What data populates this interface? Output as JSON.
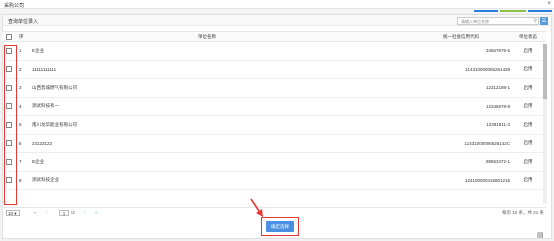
{
  "topbar": {
    "title": "采购公司",
    "close": "×"
  },
  "strip_colors": [
    "#2a7de1",
    "#8bc34a",
    "#2a7de1"
  ],
  "dialog": {
    "title": "查询单位录入",
    "close": "×",
    "search_placeholder": "请输入单位名称",
    "search_icon": "search-icon",
    "confirm_label": "确定选择"
  },
  "table": {
    "headers": {
      "index": "序",
      "name": "单位名称",
      "code": "统一社会信用代码",
      "status": "单位状态"
    },
    "rows": [
      {
        "index": "1",
        "name": "E企业",
        "code": "34567675-5",
        "status": "启用"
      },
      {
        "index": "2",
        "name": "11111111111",
        "code": "114310000065261428",
        "status": "启用"
      },
      {
        "index": "3",
        "name": "山西晋城燃气有限公司",
        "code": "12312198-1",
        "status": "启用"
      },
      {
        "index": "4",
        "name": "测试科技有一",
        "code": "12345678-9",
        "status": "启用"
      },
      {
        "index": "5",
        "name": "南川龙华能业有限公司",
        "code": "12391911-2",
        "status": "启用"
      },
      {
        "index": "6",
        "name": "23123123",
        "code": "11431000006526142C",
        "status": "启用"
      },
      {
        "index": "7",
        "name": "B企业",
        "code": "98653472-1",
        "status": "启用"
      },
      {
        "index": "8",
        "name": "测试科技企业",
        "code": "124100000415801215",
        "status": "启用"
      }
    ]
  },
  "pager": {
    "page_size": "10 ▾",
    "first": "«",
    "prev": "‹",
    "current": "1",
    "total_pages": "/2",
    "next": "›",
    "last": "»",
    "info": "每页 10 条，共 21 条"
  }
}
